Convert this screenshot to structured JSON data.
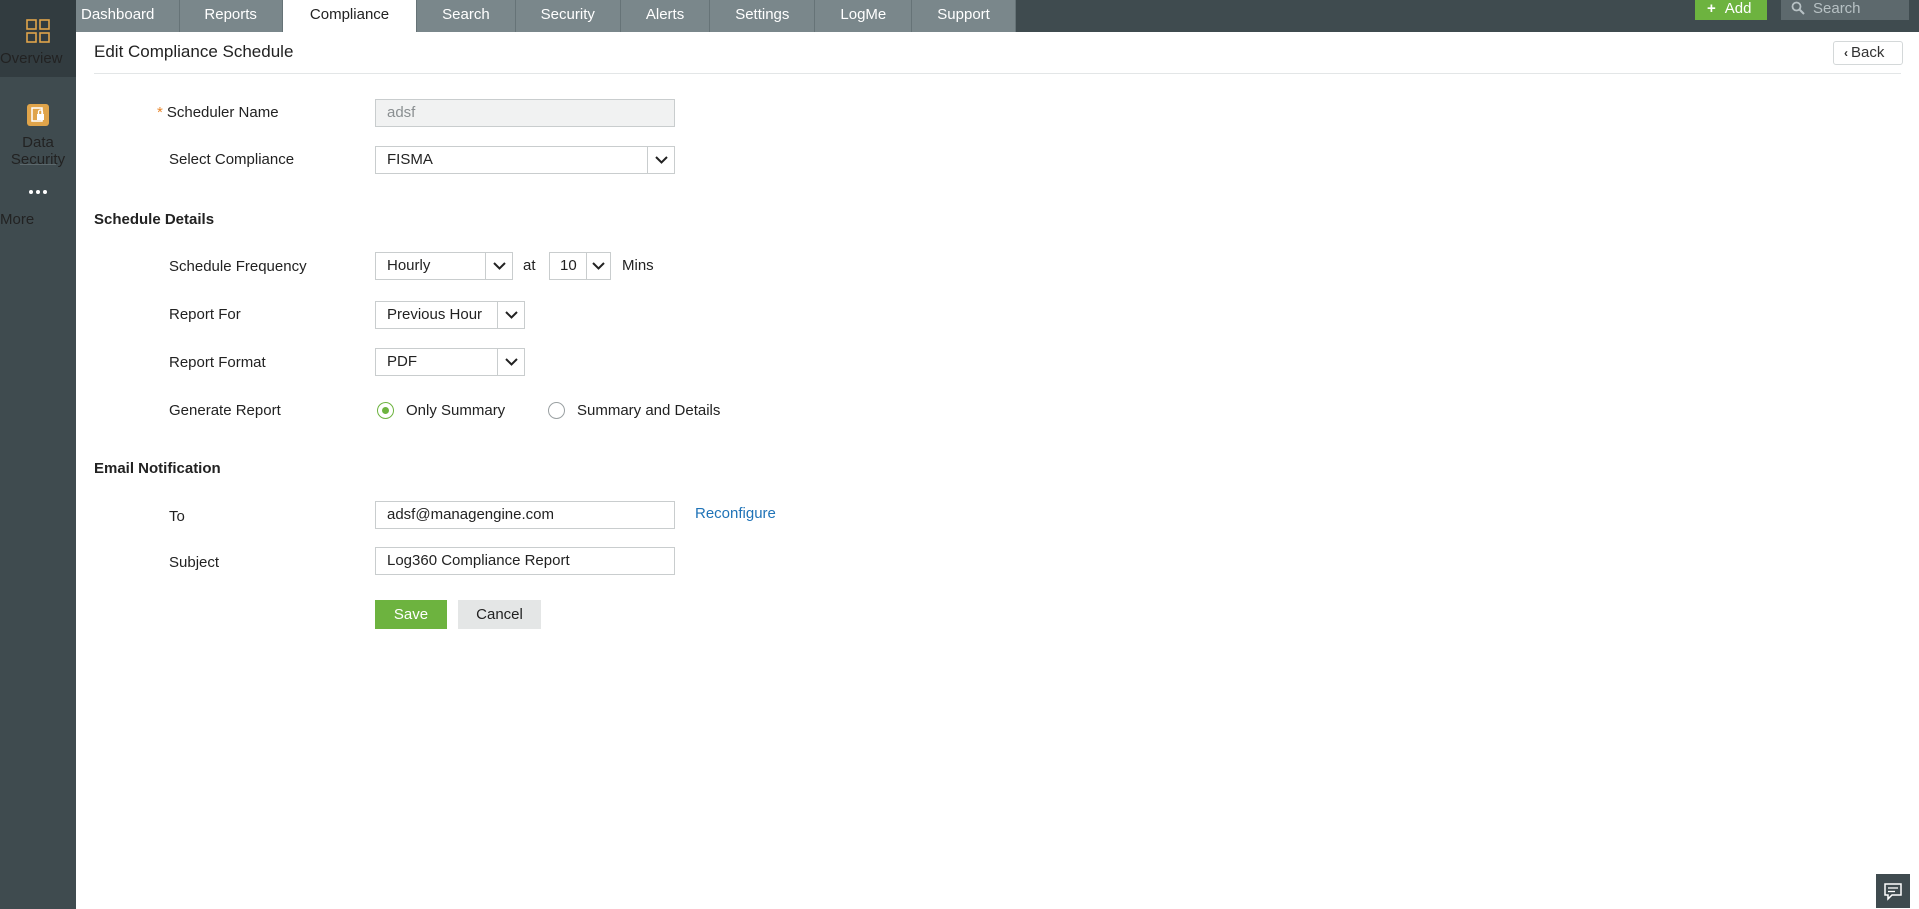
{
  "rail": {
    "items": [
      {
        "label": "Overview",
        "icon": "grid-icon"
      },
      {
        "label": "Data Security",
        "icon": "data-security-icon"
      },
      {
        "label": "More",
        "icon": "more-dots-icon"
      }
    ]
  },
  "topbar": {
    "tabs": [
      "Dashboard",
      "Reports",
      "Compliance",
      "Search",
      "Security",
      "Alerts",
      "Settings",
      "LogMe",
      "Support"
    ],
    "active_tab": "Compliance",
    "add_label": "Add",
    "search_placeholder": "Search"
  },
  "page": {
    "title": "Edit Compliance Schedule",
    "back_label": "Back"
  },
  "form": {
    "scheduler_name_label": "Scheduler Name",
    "scheduler_name_value": "adsf",
    "select_compliance_label": "Select Compliance",
    "select_compliance_value": "FISMA",
    "schedule_details_heading": "Schedule Details",
    "schedule_frequency_label": "Schedule Frequency",
    "schedule_frequency_value": "Hourly",
    "at_label": "at",
    "minute_value": "10",
    "mins_label": "Mins",
    "report_for_label": "Report For",
    "report_for_value": "Previous Hour",
    "report_format_label": "Report Format",
    "report_format_value": "PDF",
    "generate_report_label": "Generate Report",
    "generate_options": [
      "Only Summary",
      "Summary and Details"
    ],
    "generate_selected": "Only Summary",
    "email_heading": "Email Notification",
    "to_label": "To",
    "to_value": "adsf@managengine.com",
    "reconfigure_label": "Reconfigure",
    "subject_label": "Subject",
    "subject_value": "Log360 Compliance Report",
    "save_label": "Save",
    "cancel_label": "Cancel"
  },
  "colors": {
    "rail_bg": "#3f4b4f",
    "tab_bg": "#7a878b",
    "accent_green": "#6db33f",
    "link_blue": "#1f73b7",
    "required_orange": "#e8862b"
  }
}
